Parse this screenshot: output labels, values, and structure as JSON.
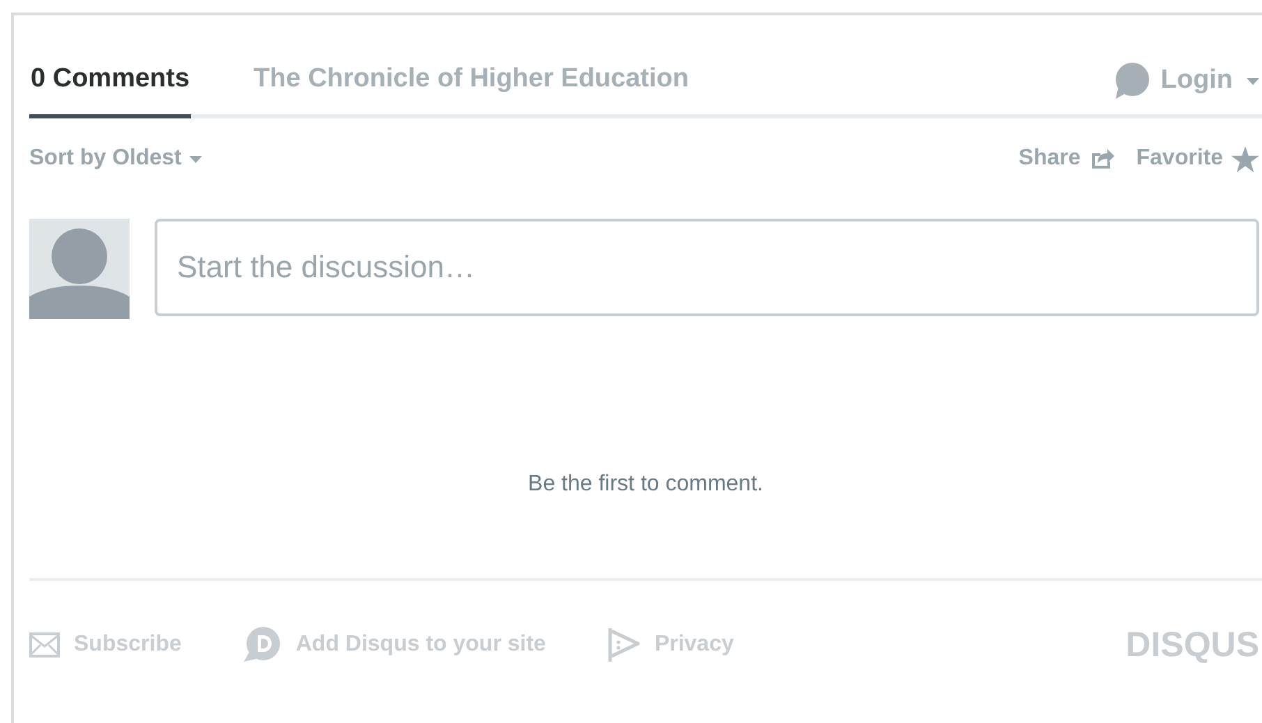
{
  "tabs": [
    {
      "label": "0 Comments",
      "selected": true
    },
    {
      "label": "The Chronicle of Higher Education",
      "selected": false
    }
  ],
  "login": {
    "label": "Login"
  },
  "sort": {
    "label": "Sort by Oldest"
  },
  "actions": [
    {
      "kind": "share",
      "label": "Share"
    },
    {
      "kind": "favorite",
      "label": "Favorite"
    }
  ],
  "composer": {
    "placeholder": "Start the discussion…"
  },
  "empty_message": "Be the first to comment.",
  "footer": {
    "links": [
      {
        "kind": "subscribe",
        "label": "Subscribe"
      },
      {
        "kind": "disqus",
        "label": "Add Disqus to your site"
      },
      {
        "kind": "privacy",
        "label": "Privacy"
      }
    ],
    "logo": "DISQUS"
  }
}
